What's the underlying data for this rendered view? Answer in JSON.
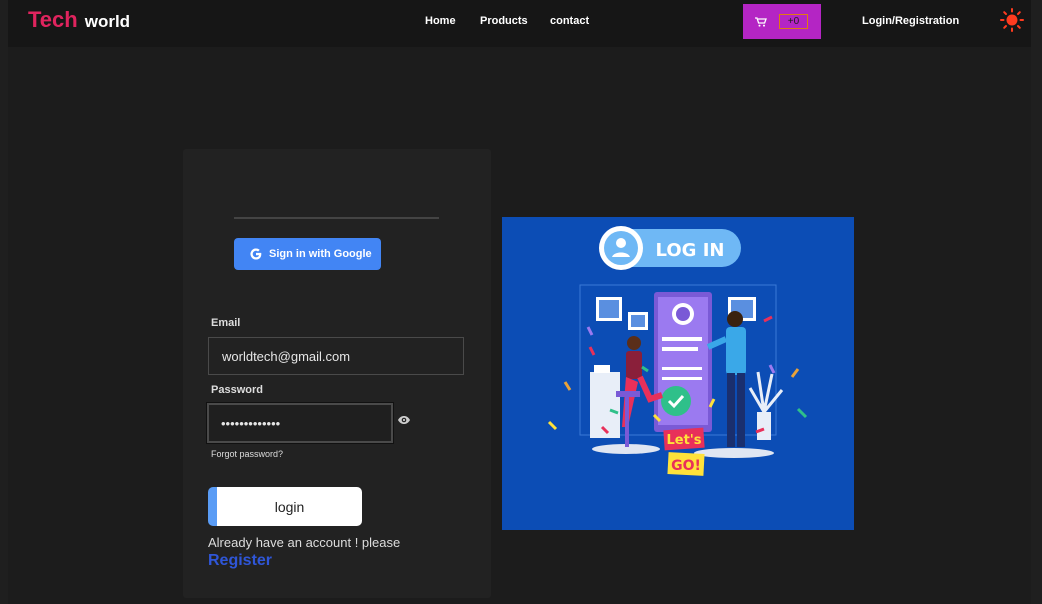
{
  "brand": {
    "part1": "Tech",
    "part2": "world"
  },
  "nav": {
    "home": "Home",
    "products": "Products",
    "contact": "contact"
  },
  "cart": {
    "count": "+0"
  },
  "header": {
    "login_registration": "Login/Registration"
  },
  "google": {
    "label": "Sign in with Google"
  },
  "form": {
    "email_label": "Email",
    "email_value": "worldtech@gmail.com",
    "password_label": "Password",
    "password_value": "•••••••••••••",
    "forgot": "Forgot password?",
    "login": "login",
    "already": "Already have an account ! please",
    "register": "Register"
  },
  "illustration": {
    "banner": "LOG IN",
    "sign_top": "Let's",
    "sign_bottom": "GO!"
  },
  "colors": {
    "brand_red": "#e0245e",
    "cart_purple": "#b425c4",
    "google_blue": "#4285f4",
    "register_blue": "#2f56d8",
    "illus_blue": "#0c4db5",
    "sun": "#ff3b1f"
  },
  "icons": [
    "cart-icon",
    "sun-icon",
    "google-g-icon",
    "eye-icon"
  ]
}
